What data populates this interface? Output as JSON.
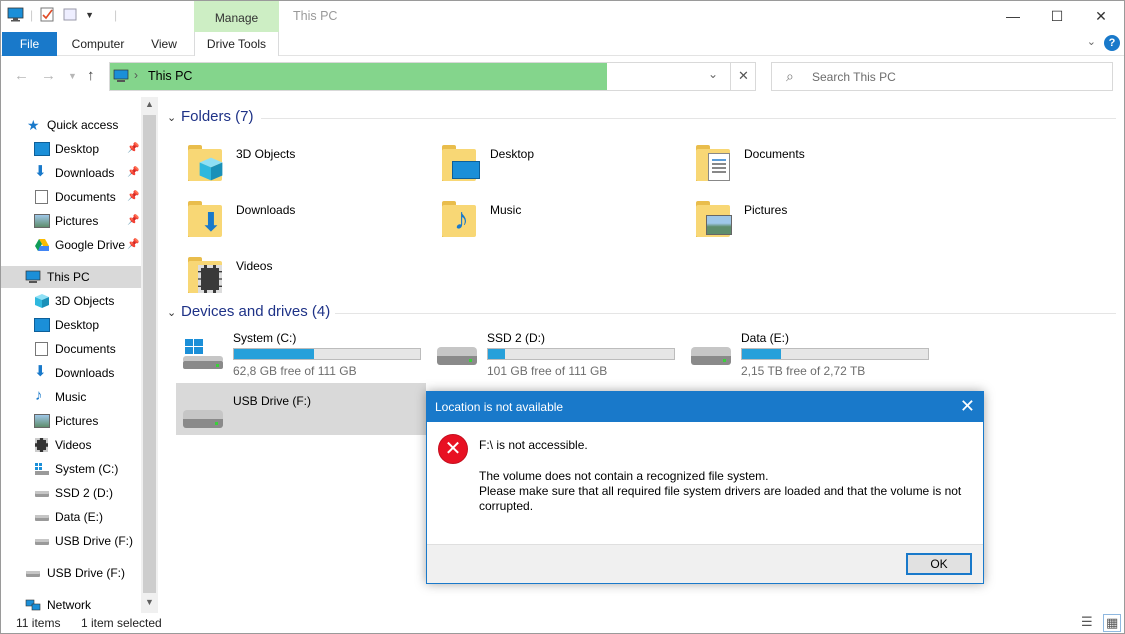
{
  "window": {
    "title": "This PC",
    "context_tab": "Manage"
  },
  "ribbon": {
    "tabs": [
      "File",
      "Computer",
      "View",
      "Drive Tools"
    ]
  },
  "address": {
    "path": "This PC",
    "search_placeholder": "Search This PC"
  },
  "nav": {
    "items": [
      {
        "label": "Quick access"
      },
      {
        "label": "Desktop"
      },
      {
        "label": "Downloads"
      },
      {
        "label": "Documents"
      },
      {
        "label": "Pictures"
      },
      {
        "label": "Google Drive"
      },
      {
        "label": "This PC"
      },
      {
        "label": "3D Objects"
      },
      {
        "label": "Desktop"
      },
      {
        "label": "Documents"
      },
      {
        "label": "Downloads"
      },
      {
        "label": "Music"
      },
      {
        "label": "Pictures"
      },
      {
        "label": "Videos"
      },
      {
        "label": "System (C:)"
      },
      {
        "label": "SSD 2 (D:)"
      },
      {
        "label": "Data (E:)"
      },
      {
        "label": "USB Drive (F:)"
      },
      {
        "label": "USB Drive (F:)"
      },
      {
        "label": "Network"
      }
    ]
  },
  "content": {
    "folders_header": "Folders (7)",
    "folders": [
      "3D Objects",
      "Desktop",
      "Documents",
      "Downloads",
      "Music",
      "Pictures",
      "Videos"
    ],
    "drives_header": "Devices and drives (4)",
    "drives": [
      {
        "name": "System (C:)",
        "free": "62,8 GB free of 111 GB",
        "used_fraction": 0.43
      },
      {
        "name": "SSD 2 (D:)",
        "free": "101 GB free of 111 GB",
        "used_fraction": 0.09
      },
      {
        "name": "Data (E:)",
        "free": "2,15 TB free of 2,72 TB",
        "used_fraction": 0.21
      },
      {
        "name": "USB Drive (F:)",
        "free": "",
        "used_fraction": 0
      }
    ]
  },
  "status": {
    "items_count": "11 items",
    "selected": "1 item selected"
  },
  "dialog": {
    "title": "Location is not available",
    "heading": "F:\\ is not accessible.",
    "line1": "The volume does not contain a recognized file system.",
    "line2": "Please make sure that all required file system drivers are loaded and that the volume is not",
    "line3": "corrupted.",
    "ok_label": "OK"
  },
  "colors": {
    "accent": "#1979ca",
    "address_highlight": "#84d58c",
    "manage_tab": "#cdeec4",
    "drive_bar": "#26a0da",
    "error": "#e81123"
  }
}
